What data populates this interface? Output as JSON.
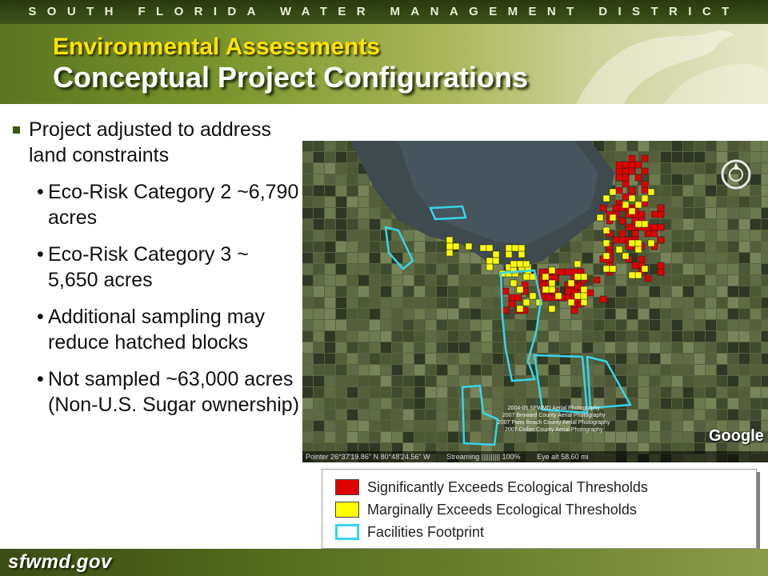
{
  "banner": "SOUTH FLORIDA WATER MANAGEMENT DISTRICT",
  "header": {
    "title": "Environmental Assessments",
    "subtitle": "Conceptual Project Configurations"
  },
  "bullets": {
    "main": "Project adjusted to address land constraints",
    "sub": [
      "Eco-Risk Category 2 ~6,790 acres",
      "Eco-Risk Category 3 ~ 5,650 acres",
      "Additional sampling may reduce hatched blocks",
      "Not sampled ~63,000 acres (Non-U.S. Sugar ownership)"
    ],
    "sub_marker": "•"
  },
  "map": {
    "credits": [
      "2004-05 SFWMD Aerial Photography",
      "2007 Broward County Aerial Photography",
      "2007 Palm Beach County Aerial Photography",
      "2007 Collier County Aerial Photography"
    ],
    "pointer": "Pointer  26°37'19.86\" N    80°48'24.56\" W",
    "streaming": "Streaming |||||||||| 100%",
    "eye_alt": "Eye alt    58.60 mi",
    "watermark": "Google"
  },
  "legend": {
    "items": [
      {
        "label": "Significantly Exceeds Ecological Thresholds",
        "color": "#e00000",
        "border": "#444444"
      },
      {
        "label": "Marginally Exceeds Ecological Thresholds",
        "color": "#ffff00",
        "border": "#444444"
      },
      {
        "label": "Facilities Footprint",
        "color": "#ffffff",
        "border": "#35d6ea"
      }
    ]
  },
  "footer": {
    "logo": "sfwmd.gov"
  },
  "colors": {
    "banner_bg": "#2f4212",
    "title_yellow": "#ffe400",
    "bullet_mark": "#3b5a12",
    "footprint_cyan": "#35d6ea",
    "exceeds_red": "#e00000",
    "marginal_yellow": "#ffff00"
  }
}
